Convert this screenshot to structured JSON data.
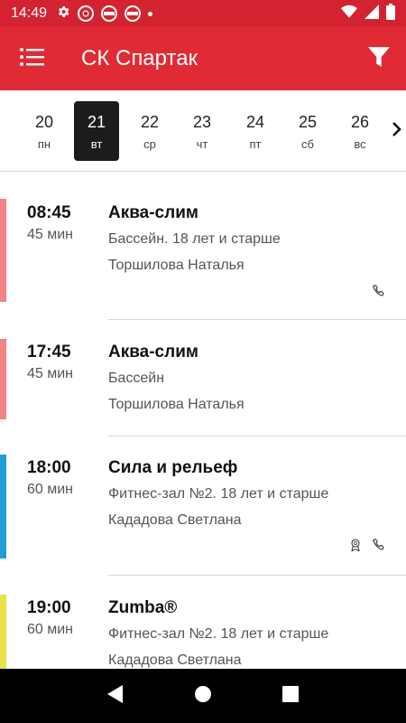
{
  "status_bar": {
    "time": "14:49",
    "left_icons": [
      "gear-icon",
      "notification-badge-icon",
      "notification-badge-icon",
      "notification-badge-icon",
      "dot-icon"
    ],
    "right_icons": [
      "wifi-icon",
      "signal-icon",
      "battery-icon"
    ]
  },
  "app_bar": {
    "title": "СК Спартак",
    "accent_color": "#e02a35"
  },
  "dates": [
    {
      "num": "20",
      "weekday": "пн",
      "selected": false
    },
    {
      "num": "21",
      "weekday": "вт",
      "selected": true
    },
    {
      "num": "22",
      "weekday": "ср",
      "selected": false
    },
    {
      "num": "23",
      "weekday": "чт",
      "selected": false
    },
    {
      "num": "24",
      "weekday": "пт",
      "selected": false
    },
    {
      "num": "25",
      "weekday": "сб",
      "selected": false
    },
    {
      "num": "26",
      "weekday": "вс",
      "selected": false
    }
  ],
  "entries": [
    {
      "time": "08:45",
      "duration": "45 мин",
      "title": "Аква-слим",
      "place": "Бассейн. 18 лет и старше",
      "trainer": "Торшилова Наталья",
      "color": "#f28383",
      "icons": [
        "phone-icon"
      ]
    },
    {
      "time": "17:45",
      "duration": "45 мин",
      "title": "Аква-слим",
      "place": "Бассейн",
      "trainer": "Торшилова Наталья",
      "color": "#f28383",
      "icons": []
    },
    {
      "time": "18:00",
      "duration": "60 мин",
      "title": "Сила и рельеф",
      "place": "Фитнес-зал №2. 18 лет и старше",
      "trainer": "Кададова Светлана",
      "color": "#1e9fd6",
      "icons": [
        "award-icon",
        "phone-icon"
      ]
    },
    {
      "time": "19:00",
      "duration": "60 мин",
      "title": "Zumba®",
      "place": "Фитнес-зал №2. 18 лет и старше",
      "trainer": "Кададова Светлана",
      "color": "#e9e24a",
      "icons": []
    }
  ]
}
